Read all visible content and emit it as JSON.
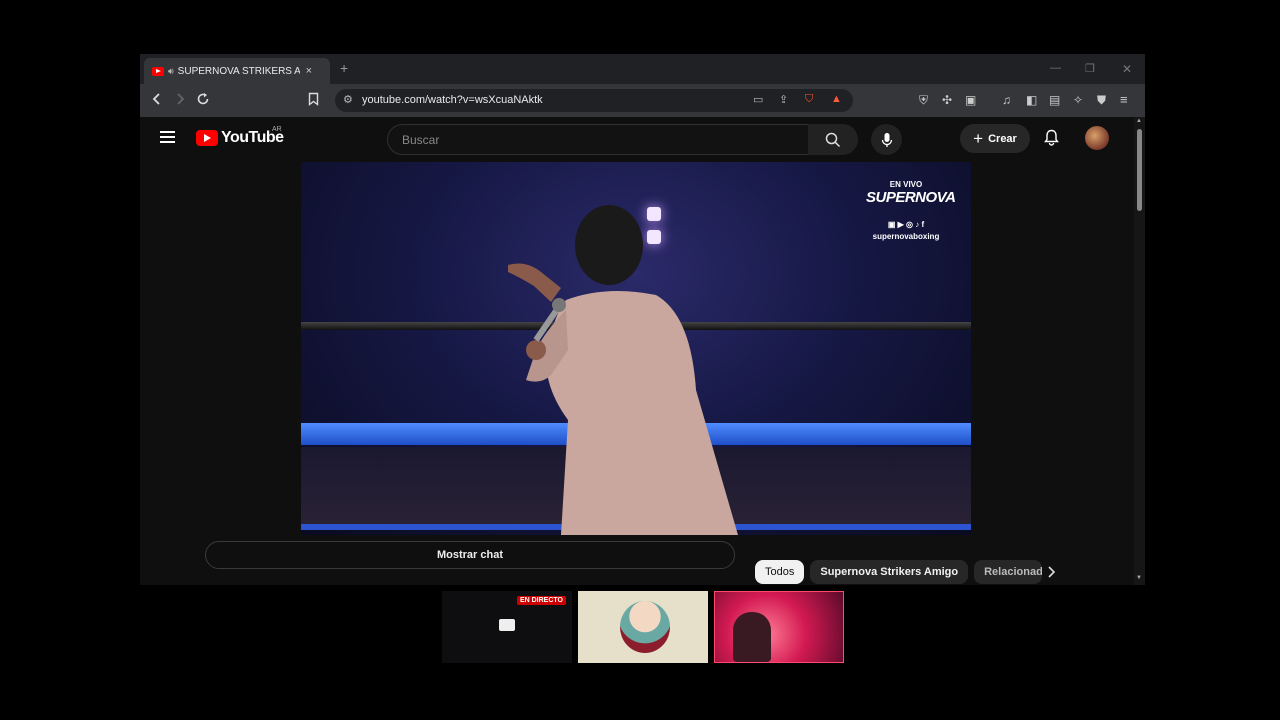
{
  "browser": {
    "tab_title": "SUPERNOVA STRIKERS AMIGO",
    "tab_close": "×",
    "new_tab": "+",
    "window_minimize": "—",
    "window_restore": "❐",
    "window_close": "✕",
    "url": "youtube.com/watch?v=wsXcuaNAktk"
  },
  "youtube": {
    "logo_text": "YouTube",
    "country_code": "AR",
    "search_placeholder": "Buscar",
    "create_label": "Crear"
  },
  "video_overlay": {
    "live_label": "EN VIVO",
    "brand": "SUPERNOVA",
    "handle": "supernovaboxing"
  },
  "chat": {
    "show_chat_label": "Mostrar chat"
  },
  "chips": [
    "Todos",
    "Supernova Strikers Amigo",
    "Relacionad"
  ],
  "thumbnails": {
    "live_badge": "EN DIRECTO"
  },
  "colors": {
    "youtube_red": "#ff0000",
    "live_badge": "#cc0000",
    "accent_blue_rope": "#2d5ee0"
  }
}
